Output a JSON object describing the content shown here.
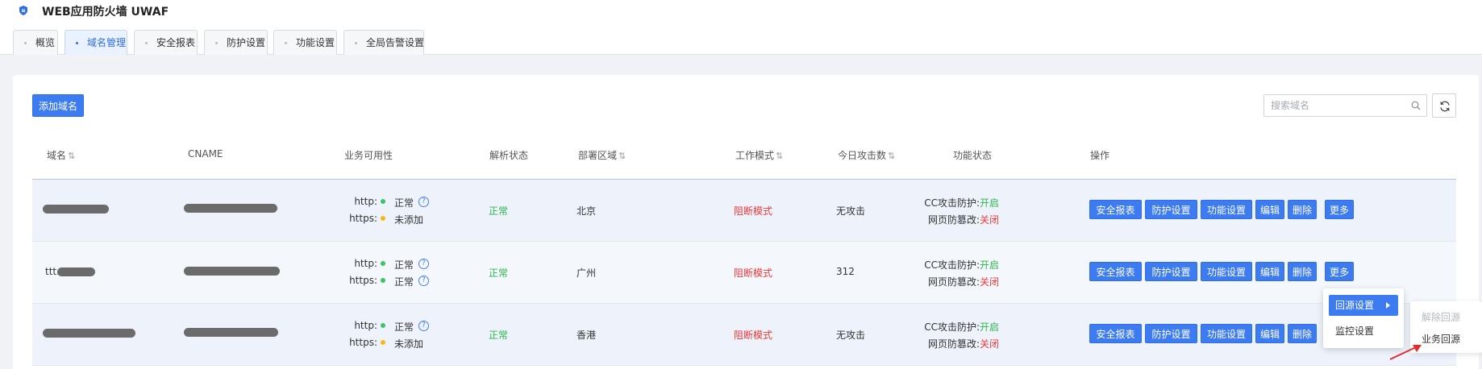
{
  "app": {
    "title": "WEB应用防火墙 UWAF",
    "logo_icon": "shield-icon"
  },
  "tabs": [
    {
      "label": "概览",
      "active": false
    },
    {
      "label": "域名管理",
      "active": true
    },
    {
      "label": "安全报表",
      "active": false
    },
    {
      "label": "防护设置",
      "active": false
    },
    {
      "label": "功能设置",
      "active": false
    },
    {
      "label": "全局告警设置",
      "active": false
    }
  ],
  "toolbar": {
    "add_label": "添加域名",
    "search_placeholder": "搜索域名",
    "search_icon": "search-icon",
    "refresh_icon": "refresh-icon"
  },
  "table": {
    "headers": {
      "domain": "域名",
      "cname": "CNAME",
      "availability": "业务可用性",
      "resolve": "解析状态",
      "region": "部署区域",
      "mode": "工作模式",
      "attacks": "今日攻击数",
      "func": "功能状态",
      "ops": "操作"
    },
    "sort_glyph": "⇅",
    "rows": [
      {
        "domain_prefix": "",
        "http_label": "http:",
        "http_status": "正常",
        "http_ok": true,
        "https_label": "https:",
        "https_status": "未添加",
        "https_ok": false,
        "resolve": "正常",
        "region": "北京",
        "mode": "阻断模式",
        "attacks": "无攻击",
        "cc_label": "CC攻击防护:",
        "cc_value": "开启",
        "tamper_label": "网页防篡改:",
        "tamper_value": "关闭"
      },
      {
        "domain_prefix": "ttt.",
        "http_label": "http:",
        "http_status": "正常",
        "http_ok": true,
        "https_label": "https:",
        "https_status": "正常",
        "https_ok": true,
        "resolve": "正常",
        "region": "广州",
        "mode": "阻断模式",
        "attacks": "312",
        "cc_label": "CC攻击防护:",
        "cc_value": "开启",
        "tamper_label": "网页防篡改:",
        "tamper_value": "关闭"
      },
      {
        "domain_prefix": "",
        "http_label": "http:",
        "http_status": "正常",
        "http_ok": true,
        "https_label": "https:",
        "https_status": "未添加",
        "https_ok": false,
        "resolve": "正常",
        "region": "香港",
        "mode": "阻断模式",
        "attacks": "无攻击",
        "cc_label": "CC攻击防护:",
        "cc_value": "开启",
        "tamper_label": "网页防篡改:",
        "tamper_value": "关闭"
      }
    ],
    "actions": {
      "report": "安全报表",
      "protect": "防护设置",
      "func": "功能设置",
      "edit": "编辑",
      "delete": "删除",
      "more": "更多"
    },
    "help_glyph": "?"
  },
  "more_menu": {
    "item_active": "回源设置",
    "item_monitor": "监控设置"
  },
  "submenu": {
    "item_disabled": "解除回源",
    "item_business": "业务回源"
  },
  "colors": {
    "primary": "#3d7bf0",
    "ok": "#2fb84f",
    "danger": "#ee3a3a",
    "warn": "#f5b818"
  }
}
